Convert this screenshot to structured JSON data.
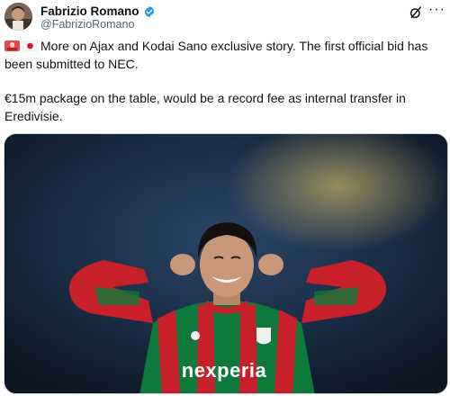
{
  "author": {
    "display_name": "Fabrizio Romano",
    "handle": "@FabrizioRomano",
    "avatar_icon": "profile-photo",
    "verified_icon": "verified-badge-icon"
  },
  "header_actions": {
    "grok_icon": "grok-icon",
    "more_icon": "more-options-icon",
    "more_glyph": "···"
  },
  "tweet": {
    "flags": [
      "siren-emoji",
      "japan-flag-emoji"
    ],
    "paragraph_1": "More on Ajax and Kodai Sano exclusive story. The first official bid has been submitted to NEC.",
    "paragraph_2": "€15m package on the table, would be a record fee as internal transfer in Eredivisie."
  },
  "media": {
    "description_icon": "football-player-photo",
    "shirt_sponsor": "nexperia"
  },
  "colors": {
    "text": "#0f1419",
    "secondary_text": "#536471",
    "verified_blue": "#1d9bf0",
    "shirt_red": "#c8202a",
    "shirt_green": "#0d7a3b",
    "background": "#ffffff"
  }
}
